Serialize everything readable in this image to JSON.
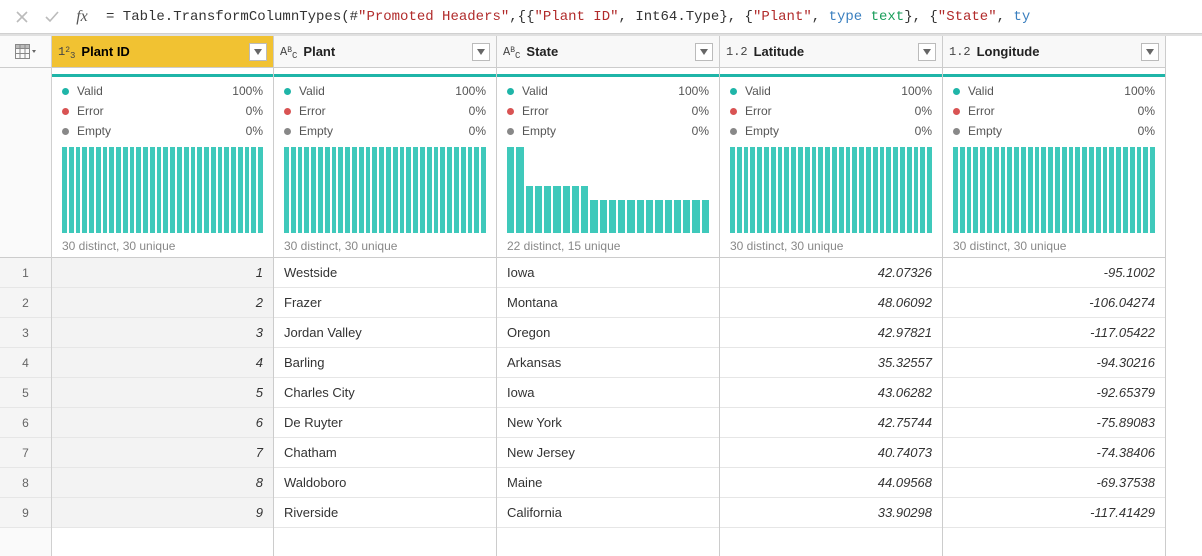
{
  "formula": {
    "prefix": "= Table.TransformColumnTypes(#",
    "promoted": "\"Promoted Headers\"",
    "mid1": ",{{",
    "col1": "\"Plant ID\"",
    "mid2": ", Int64.Type}, {",
    "col2": "\"Plant\"",
    "mid3": ", ",
    "kw1": "type",
    "sp1": " ",
    "ty1": "text",
    "mid4": "}, {",
    "col3": "\"State\"",
    "mid5": ", ",
    "kw2": "ty"
  },
  "quality": {
    "valid_label": "Valid",
    "error_label": "Error",
    "empty_label": "Empty",
    "valid_pct": "100%",
    "error_pct": "0%",
    "empty_pct": "0%"
  },
  "columns": [
    {
      "name": "Plant ID",
      "type": "int",
      "type_label": "1²₃",
      "selected": true,
      "distinct": "30 distinct, 30 unique",
      "bars": [
        1,
        1,
        1,
        1,
        1,
        1,
        1,
        1,
        1,
        1,
        1,
        1,
        1,
        1,
        1,
        1,
        1,
        1,
        1,
        1,
        1,
        1,
        1,
        1,
        1,
        1,
        1,
        1,
        1,
        1
      ],
      "align": "num"
    },
    {
      "name": "Plant",
      "type": "text",
      "type_label": "AᴮC",
      "selected": false,
      "distinct": "30 distinct, 30 unique",
      "bars": [
        1,
        1,
        1,
        1,
        1,
        1,
        1,
        1,
        1,
        1,
        1,
        1,
        1,
        1,
        1,
        1,
        1,
        1,
        1,
        1,
        1,
        1,
        1,
        1,
        1,
        1,
        1,
        1,
        1,
        1
      ],
      "align": "text"
    },
    {
      "name": "State",
      "type": "text",
      "type_label": "AᴮC",
      "selected": false,
      "distinct": "22 distinct, 15 unique",
      "bars": [
        1,
        1,
        0.55,
        0.55,
        0.55,
        0.55,
        0.55,
        0.55,
        0.55,
        0.38,
        0.38,
        0.38,
        0.38,
        0.38,
        0.38,
        0.38,
        0.38,
        0.38,
        0.38,
        0.38,
        0.38,
        0.38
      ],
      "align": "text"
    },
    {
      "name": "Latitude",
      "type": "decimal",
      "type_label": "1.2",
      "selected": false,
      "distinct": "30 distinct, 30 unique",
      "bars": [
        1,
        1,
        1,
        1,
        1,
        1,
        1,
        1,
        1,
        1,
        1,
        1,
        1,
        1,
        1,
        1,
        1,
        1,
        1,
        1,
        1,
        1,
        1,
        1,
        1,
        1,
        1,
        1,
        1,
        1
      ],
      "align": "num"
    },
    {
      "name": "Longitude",
      "type": "decimal",
      "type_label": "1.2",
      "selected": false,
      "distinct": "30 distinct, 30 unique",
      "bars": [
        1,
        1,
        1,
        1,
        1,
        1,
        1,
        1,
        1,
        1,
        1,
        1,
        1,
        1,
        1,
        1,
        1,
        1,
        1,
        1,
        1,
        1,
        1,
        1,
        1,
        1,
        1,
        1,
        1,
        1
      ],
      "align": "num"
    }
  ],
  "rows": [
    {
      "n": "1",
      "cells": [
        "1",
        "Westside",
        "Iowa",
        "42.07326",
        "-95.1002"
      ]
    },
    {
      "n": "2",
      "cells": [
        "2",
        "Frazer",
        "Montana",
        "48.06092",
        "-106.04274"
      ]
    },
    {
      "n": "3",
      "cells": [
        "3",
        "Jordan Valley",
        "Oregon",
        "42.97821",
        "-117.05422"
      ]
    },
    {
      "n": "4",
      "cells": [
        "4",
        "Barling",
        "Arkansas",
        "35.32557",
        "-94.30216"
      ]
    },
    {
      "n": "5",
      "cells": [
        "5",
        "Charles City",
        "Iowa",
        "43.06282",
        "-92.65379"
      ]
    },
    {
      "n": "6",
      "cells": [
        "6",
        "De Ruyter",
        "New York",
        "42.75744",
        "-75.89083"
      ]
    },
    {
      "n": "7",
      "cells": [
        "7",
        "Chatham",
        "New Jersey",
        "40.74073",
        "-74.38406"
      ]
    },
    {
      "n": "8",
      "cells": [
        "8",
        "Waldoboro",
        "Maine",
        "44.09568",
        "-69.37538"
      ]
    },
    {
      "n": "9",
      "cells": [
        "9",
        "Riverside",
        "California",
        "33.90298",
        "-117.41429"
      ]
    }
  ]
}
